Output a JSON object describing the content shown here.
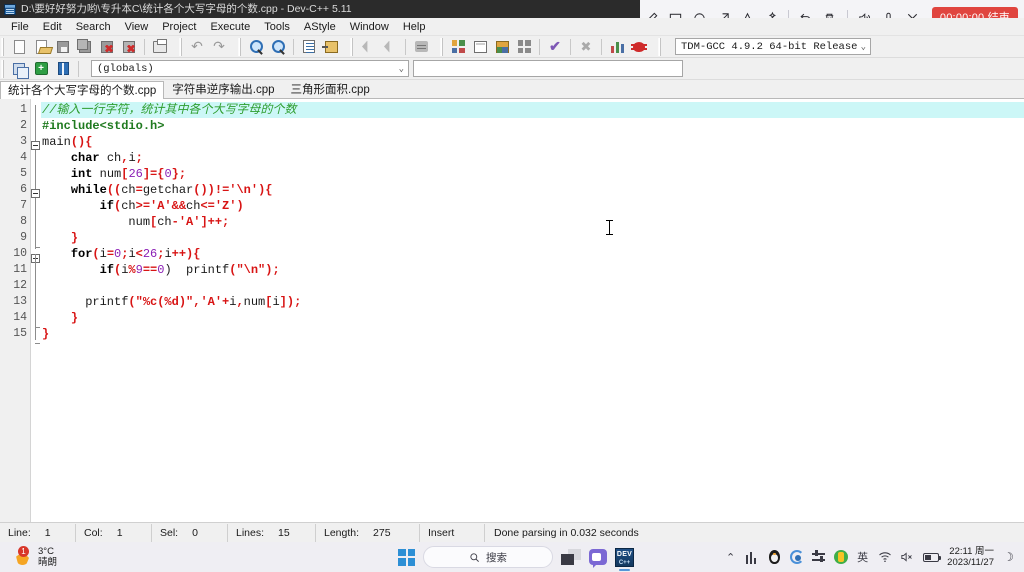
{
  "window": {
    "title": "D:\\要好好努力哟\\专升本C\\统计各个大写字母的个数.cpp - Dev-C++ 5.11",
    "icon": "dev-cpp-icon"
  },
  "recorder": {
    "tools": [
      {
        "name": "pen-icon",
        "label": "✎"
      },
      {
        "name": "rectangle-icon",
        "label": "▭"
      },
      {
        "name": "ellipse-icon",
        "label": "◯"
      },
      {
        "name": "arrow-icon",
        "label": "↗"
      },
      {
        "name": "text-icon",
        "label": "A"
      },
      {
        "name": "magic-wand-icon",
        "label": "✨"
      }
    ],
    "actions": [
      {
        "name": "undo-icon",
        "label": "↺"
      },
      {
        "name": "trash-icon",
        "label": "🗑"
      }
    ],
    "audio": [
      {
        "name": "speaker-icon",
        "label": "🔊"
      },
      {
        "name": "microphone-icon",
        "label": "🎤"
      }
    ],
    "close_label": "✕",
    "timer_label": "00:00:00 结束",
    "timer_color": "#e0453f"
  },
  "menubar": {
    "items": [
      {
        "label": "File",
        "accel": "F"
      },
      {
        "label": "Edit",
        "accel": "E"
      },
      {
        "label": "Search",
        "accel": "S"
      },
      {
        "label": "View",
        "accel": "V"
      },
      {
        "label": "Project",
        "accel": "P"
      },
      {
        "label": "Execute",
        "accel": "x"
      },
      {
        "label": "Tools",
        "accel": "T"
      },
      {
        "label": "AStyle",
        "accel": "A"
      },
      {
        "label": "Window",
        "accel": "W"
      },
      {
        "label": "Help",
        "accel": "H"
      }
    ]
  },
  "toolbar": {
    "compiler_value": "TDM-GCC 4.9.2 64-bit Release",
    "globals_value": "(globals)",
    "blank_value": ""
  },
  "tabs": [
    {
      "label": "统计各个大写字母的个数.cpp",
      "active": true
    },
    {
      "label": "字符串逆序输出.cpp",
      "active": false
    },
    {
      "label": "三角形面积.cpp",
      "active": false
    }
  ],
  "editor": {
    "line_numbers": [
      "1",
      "2",
      "3",
      "4",
      "5",
      "6",
      "7",
      "8",
      "9",
      "10",
      "11",
      "12",
      "13",
      "14",
      "15"
    ],
    "lines": [
      {
        "n": 1,
        "current": true,
        "tokens": [
          {
            "t": "//输入一行字符，统计其中各个大写字母的个数",
            "c": "cm"
          }
        ]
      },
      {
        "n": 2,
        "current": false,
        "tokens": [
          {
            "t": "#include<stdio.h>",
            "c": "pre"
          }
        ]
      },
      {
        "n": 3,
        "current": false,
        "tokens": [
          {
            "t": "main",
            "c": "id"
          },
          {
            "t": "(){",
            "c": "p"
          }
        ]
      },
      {
        "n": 4,
        "current": false,
        "tokens": [
          {
            "t": "    ",
            "c": "id"
          },
          {
            "t": "char",
            "c": "k"
          },
          {
            "t": " ch",
            "c": "id"
          },
          {
            "t": ",",
            "c": "p"
          },
          {
            "t": "i",
            "c": "id"
          },
          {
            "t": ";",
            "c": "p"
          }
        ]
      },
      {
        "n": 5,
        "current": false,
        "tokens": [
          {
            "t": "    ",
            "c": "id"
          },
          {
            "t": "int",
            "c": "k"
          },
          {
            "t": " num",
            "c": "id"
          },
          {
            "t": "[",
            "c": "p"
          },
          {
            "t": "26",
            "c": "n"
          },
          {
            "t": "]={",
            "c": "p"
          },
          {
            "t": "0",
            "c": "n"
          },
          {
            "t": "};",
            "c": "p"
          }
        ]
      },
      {
        "n": 6,
        "current": false,
        "tokens": [
          {
            "t": "    ",
            "c": "id"
          },
          {
            "t": "while",
            "c": "k"
          },
          {
            "t": "((",
            "c": "p"
          },
          {
            "t": "ch",
            "c": "id"
          },
          {
            "t": "=",
            "c": "p"
          },
          {
            "t": "getchar",
            "c": "id"
          },
          {
            "t": "())!=",
            "c": "p"
          },
          {
            "t": "'\\n'",
            "c": "s"
          },
          {
            "t": "){",
            "c": "p"
          }
        ]
      },
      {
        "n": 7,
        "current": false,
        "tokens": [
          {
            "t": "        ",
            "c": "id"
          },
          {
            "t": "if",
            "c": "k"
          },
          {
            "t": "(",
            "c": "p"
          },
          {
            "t": "ch",
            "c": "id"
          },
          {
            "t": ">=",
            "c": "p"
          },
          {
            "t": "'A'",
            "c": "s"
          },
          {
            "t": "&&",
            "c": "p"
          },
          {
            "t": "ch",
            "c": "id"
          },
          {
            "t": "<=",
            "c": "p"
          },
          {
            "t": "'Z'",
            "c": "s"
          },
          {
            "t": ")",
            "c": "p"
          }
        ]
      },
      {
        "n": 8,
        "current": false,
        "tokens": [
          {
            "t": "            num",
            "c": "id"
          },
          {
            "t": "[",
            "c": "p"
          },
          {
            "t": "ch",
            "c": "id"
          },
          {
            "t": "-",
            "c": "p"
          },
          {
            "t": "'A'",
            "c": "s"
          },
          {
            "t": "]++;",
            "c": "p"
          }
        ]
      },
      {
        "n": 9,
        "current": false,
        "tokens": [
          {
            "t": "    ",
            "c": "id"
          },
          {
            "t": "}",
            "c": "p"
          }
        ]
      },
      {
        "n": 10,
        "current": false,
        "tokens": [
          {
            "t": "    ",
            "c": "id"
          },
          {
            "t": "for",
            "c": "k"
          },
          {
            "t": "(",
            "c": "p"
          },
          {
            "t": "i",
            "c": "id"
          },
          {
            "t": "=",
            "c": "p"
          },
          {
            "t": "0",
            "c": "n"
          },
          {
            "t": ";",
            "c": "p"
          },
          {
            "t": "i",
            "c": "id"
          },
          {
            "t": "<",
            "c": "p"
          },
          {
            "t": "26",
            "c": "n"
          },
          {
            "t": ";",
            "c": "p"
          },
          {
            "t": "i",
            "c": "id"
          },
          {
            "t": "++){",
            "c": "p"
          }
        ]
      },
      {
        "n": 11,
        "current": false,
        "tokens": [
          {
            "t": "        ",
            "c": "id"
          },
          {
            "t": "if",
            "c": "k"
          },
          {
            "t": "(",
            "c": "p"
          },
          {
            "t": "i",
            "c": "id"
          },
          {
            "t": "%",
            "c": "p"
          },
          {
            "t": "9",
            "c": "n"
          },
          {
            "t": "==",
            "c": "p"
          },
          {
            "t": "0",
            "c": "n"
          },
          {
            "t": ")  printf",
            "c": "id"
          },
          {
            "t": "(",
            "c": "p"
          },
          {
            "t": "\"\\n\"",
            "c": "s"
          },
          {
            "t": ");",
            "c": "p"
          }
        ]
      },
      {
        "n": 12,
        "current": false,
        "tokens": [
          {
            "t": "",
            "c": "id"
          }
        ]
      },
      {
        "n": 13,
        "current": false,
        "tokens": [
          {
            "t": "      printf",
            "c": "id"
          },
          {
            "t": "(",
            "c": "p"
          },
          {
            "t": "\"%c(%d)\"",
            "c": "s"
          },
          {
            "t": ",",
            "c": "p"
          },
          {
            "t": "'A'",
            "c": "s"
          },
          {
            "t": "+",
            "c": "p"
          },
          {
            "t": "i",
            "c": "id"
          },
          {
            "t": ",",
            "c": "p"
          },
          {
            "t": "num",
            "c": "id"
          },
          {
            "t": "[",
            "c": "p"
          },
          {
            "t": "i",
            "c": "id"
          },
          {
            "t": "]);",
            "c": "p"
          }
        ]
      },
      {
        "n": 14,
        "current": false,
        "tokens": [
          {
            "t": "    ",
            "c": "id"
          },
          {
            "t": "}",
            "c": "p"
          }
        ]
      },
      {
        "n": 15,
        "current": false,
        "tokens": [
          {
            "t": "}",
            "c": "p"
          }
        ]
      }
    ]
  },
  "statusbar": {
    "line_label": "Line:",
    "line_value": "1",
    "col_label": "Col:",
    "col_value": "1",
    "sel_label": "Sel:",
    "sel_value": "0",
    "lines_label": "Lines:",
    "lines_value": "15",
    "length_label": "Length:",
    "length_value": "275",
    "mode": "Insert",
    "message": "Done parsing in 0.032 seconds"
  },
  "taskbar": {
    "weather_temp": "3°C",
    "weather_desc": "晴朗",
    "weather_badge": "1",
    "search_placeholder": "搜索",
    "tray": {
      "ime": "英",
      "clock_time": "22:11 周一",
      "clock_date": "2023/11/27"
    }
  }
}
